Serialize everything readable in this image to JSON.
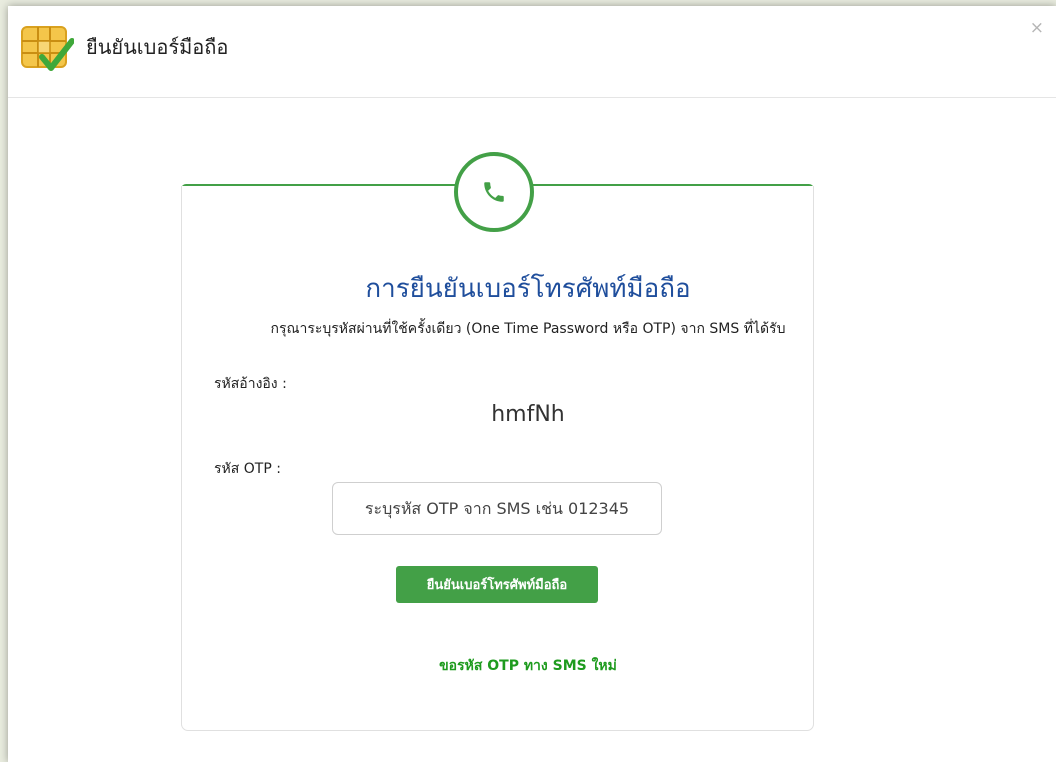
{
  "dialog": {
    "title": "ยืนยันเบอร์มือถือ",
    "close_label": "×",
    "header_icon": "sim-card-check-icon"
  },
  "card": {
    "icon": "phone-icon",
    "title": "การยืนยันเบอร์โทรศัพท์มือถือ",
    "instruction": "กรุณาระบุรหัสผ่านที่ใช้ครั้งเดียว (One Time Password หรือ OTP) จาก SMS ที่ได้รับ",
    "reference_label": "รหัสอ้างอิง :",
    "reference_value": "hmfNh",
    "otp_label": "รหัส OTP :",
    "otp_placeholder": "ระบุรหัส OTP จาก SMS เช่น 012345",
    "otp_value": "",
    "confirm_button": "ยืนยันเบอร์โทรศัพท์มือถือ",
    "resend_link": "ขอรหัส OTP ทาง SMS ใหม่"
  },
  "colors": {
    "accent_green": "#43a047",
    "title_blue": "#1f4e9c",
    "link_green": "#1e9b1e"
  }
}
